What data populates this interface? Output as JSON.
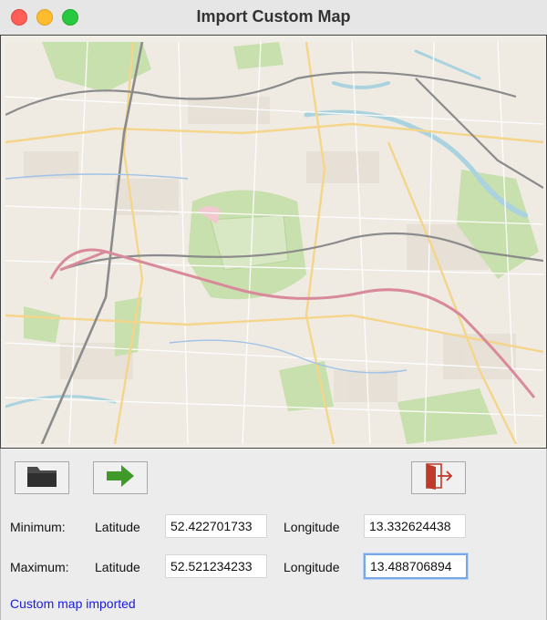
{
  "window": {
    "title": "Import Custom Map"
  },
  "toolbar": {
    "open_icon": "folder-icon",
    "next_icon": "arrow-right-icon",
    "exit_icon": "exit-door-icon"
  },
  "form": {
    "minimum": {
      "label": "Minimum:",
      "latitude_label": "Latitude",
      "latitude_value": "52.422701733",
      "longitude_label": "Longitude",
      "longitude_value": "13.332624438"
    },
    "maximum": {
      "label": "Maximum:",
      "latitude_label": "Latitude",
      "latitude_value": "52.521234233",
      "longitude_label": "Longitude",
      "longitude_value": "13.488706894"
    }
  },
  "status": {
    "message": "Custom map imported",
    "color": "#1a1add"
  },
  "colors": {
    "window_bg": "#ececec",
    "map_bg": "#f2efe9",
    "park_green": "#c8dfae",
    "water_blue": "#aad3df",
    "rail_red": "#d98a9a",
    "arrow_green": "#3f9a2a",
    "exit_red": "#c0392b"
  }
}
